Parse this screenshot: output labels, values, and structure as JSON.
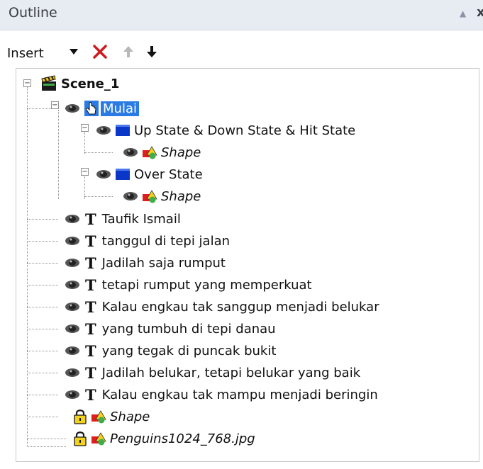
{
  "panel": {
    "title": "Outline",
    "pin_glyph": "▲",
    "close_glyph": "x"
  },
  "toolbar": {
    "insert_label": "Insert",
    "dropdown_icon": "caret-down-icon",
    "delete_icon": "delete-x-icon",
    "move_up_icon": "arrow-up-icon",
    "move_down_icon": "arrow-down-icon",
    "delete_color": "#d0191c",
    "disabled_color": "#b8b8b8"
  },
  "tree": {
    "scene": {
      "label": "Scene_1",
      "icon": "clapperboard-icon"
    },
    "button": {
      "label": "Mulai",
      "icon": "hand-pointer-icon",
      "selected": true
    },
    "states": [
      {
        "label": "Up State & Down State & Hit State",
        "icon": "blue-square-icon",
        "child": "Shape"
      },
      {
        "label": "Over State",
        "icon": "blue-square-icon",
        "child": "Shape"
      }
    ],
    "texts": [
      "Taufik Ismail",
      "tanggul di tepi jalan",
      "Jadilah saja rumput",
      "tetapi rumput yang memperkuat",
      "Kalau engkau tak sanggup menjadi belukar",
      "yang tumbuh di tepi danau",
      "yang tegak di puncak bukit",
      "Jadilah belukar, tetapi belukar yang baik",
      "Kalau engkau tak mampu menjadi beringin"
    ],
    "locked": [
      {
        "label": "Shape"
      },
      {
        "label": "Penguins1024_768.jpg"
      }
    ],
    "text_icon_glyph": "T",
    "collapse_glyph": "−"
  },
  "colors": {
    "selection": "#2a7be4",
    "titlebar": "#e7ecf2"
  }
}
